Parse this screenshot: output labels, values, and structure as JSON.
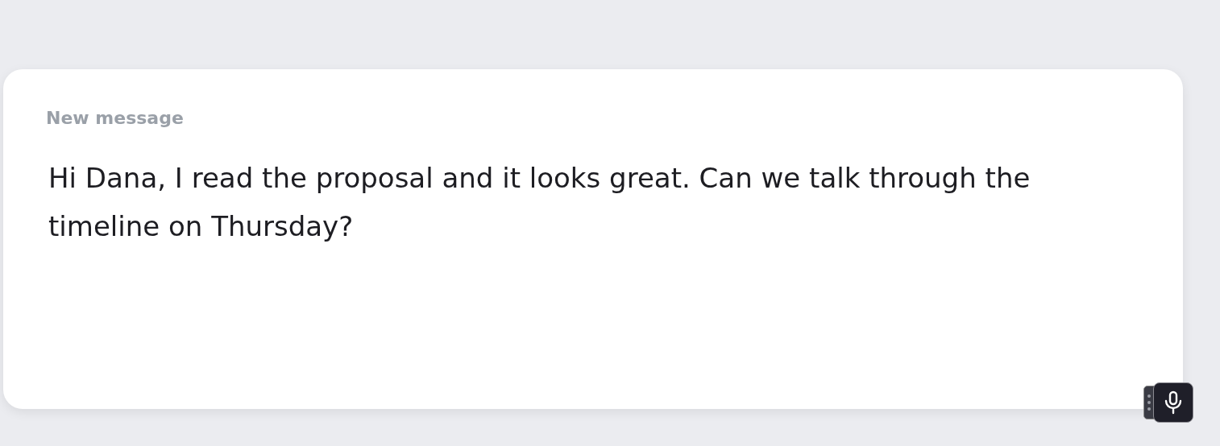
{
  "compose": {
    "label": "New message",
    "value": "Hi Dana, I read the proposal and it looks great. Can we talk through the timeline on Thursday?"
  }
}
